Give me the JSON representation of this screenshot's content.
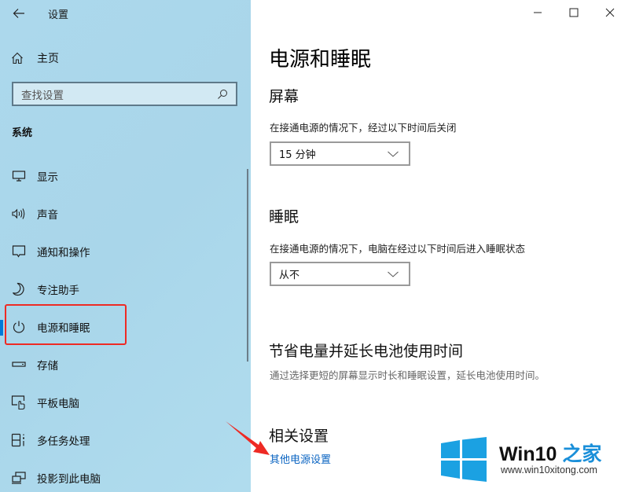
{
  "window": {
    "title": "设置",
    "controls": {
      "minimize": "minimize-icon",
      "maximize": "maximize-icon",
      "close": "close-icon"
    }
  },
  "sidebar": {
    "back_icon": "back-arrow-icon",
    "home": {
      "label": "主页",
      "icon": "home-icon"
    },
    "search": {
      "placeholder": "查找设置",
      "icon": "search-icon"
    },
    "section": "系统",
    "items": [
      {
        "label": "显示",
        "icon": "monitor-icon"
      },
      {
        "label": "声音",
        "icon": "speaker-icon"
      },
      {
        "label": "通知和操作",
        "icon": "notification-icon"
      },
      {
        "label": "专注助手",
        "icon": "moon-icon"
      },
      {
        "label": "电源和睡眠",
        "icon": "power-icon",
        "selected": true
      },
      {
        "label": "存储",
        "icon": "storage-icon"
      },
      {
        "label": "平板电脑",
        "icon": "tablet-icon"
      },
      {
        "label": "多任务处理",
        "icon": "multitask-icon"
      },
      {
        "label": "投影到此电脑",
        "icon": "project-icon"
      }
    ]
  },
  "main": {
    "page_title": "电源和睡眠",
    "screen": {
      "heading": "屏幕",
      "description": "在接通电源的情况下，经过以下时间后关闭",
      "dropdown_value": "15 分钟"
    },
    "sleep": {
      "heading": "睡眠",
      "description": "在接通电源的情况下，电脑在经过以下时间后进入睡眠状态",
      "dropdown_value": "从不"
    },
    "battery": {
      "heading": "节省电量并延长电池使用时间",
      "description": "通过选择更短的屏幕显示时长和睡眠设置，延长电池使用时间。"
    },
    "related": {
      "heading": "相关设置",
      "link": "其他电源设置"
    }
  },
  "watermark": {
    "brand_main": "Win10",
    "brand_accent": "之家",
    "url": "www.win10xitong.com"
  },
  "colors": {
    "sidebar_bg": "#acd8ec",
    "accent": "#0078d7",
    "link": "#0a64c2",
    "annotation": "#ee2a24"
  }
}
